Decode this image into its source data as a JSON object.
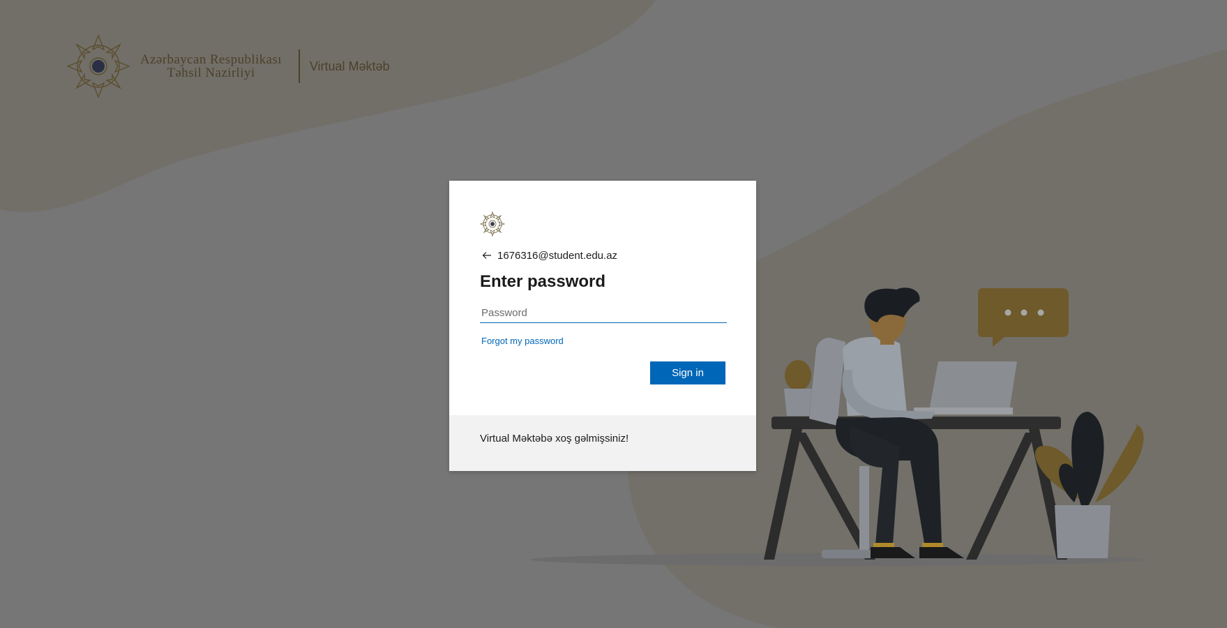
{
  "brand": {
    "ministry_line1": "Azərbaycan Respublikası",
    "ministry_line2": "Təhsil Nazirliyi",
    "app_name": "Virtual Məktəb"
  },
  "dialog": {
    "identity": "1676316@student.edu.az",
    "title": "Enter password",
    "password_placeholder": "Password",
    "password_value": "",
    "forgot_link": "Forgot my password",
    "signin_label": "Sign in",
    "footer_text": "Virtual Məktəbə xoş gəlmişsiniz!"
  },
  "colors": {
    "accent": "#0067b8",
    "background": "#767676",
    "brand_gold": "#4a4128"
  },
  "icons": {
    "emblem": "ministry-emblem-icon",
    "back": "arrow-left-icon",
    "chat": "chat-bubble-icon"
  }
}
